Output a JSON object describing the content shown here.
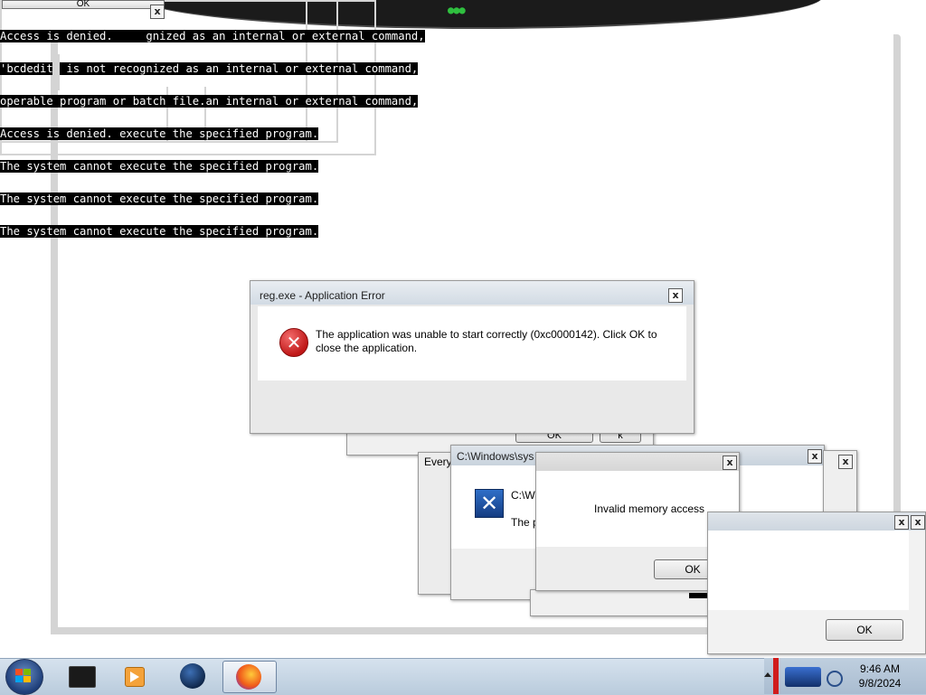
{
  "console": {
    "lines": [
      "Access is denied.     gnized as an internal or external command,",
      "'bcdedit' is not recognized as an internal or external command,",
      "operable program or batch file.an internal or external command,",
      "Access is denied. execute the specified program.",
      "The system cannot execute the specified program.",
      "The system cannot execute the specified program.",
      "The system cannot execute the specified program."
    ],
    "ok_fragment": "OK",
    "close_glyph": "x"
  },
  "main_error": {
    "title": "reg.exe - Application Error",
    "message_line1": "The application was unable to start correctly (0xc0000142). Click OK to",
    "message_line2": "close the application.",
    "close_glyph": "x",
    "icon": "error-icon"
  },
  "behind_dialogs": {
    "ok_fragment": "OK",
    "other_fragment": "k",
    "every_fragment": "Every"
  },
  "cmd_dialog": {
    "title": "C:\\Windows\\sys",
    "text_line1": "C:\\W",
    "text_line2": "The p",
    "close_glyph": "x",
    "icon": "blue-x-icon"
  },
  "memory_dialog": {
    "message": "Invalid memory access",
    "ok_label": "OK",
    "close_glyph": "x"
  },
  "front_dialog": {
    "ok_label": "OK",
    "close_glyph": "x"
  },
  "taskbar": {
    "time": "9:46 AM",
    "date": "9/8/2024",
    "apps": [
      "terminal-icon",
      "media-player-icon",
      "globe-icon",
      "firefox-icon"
    ]
  }
}
